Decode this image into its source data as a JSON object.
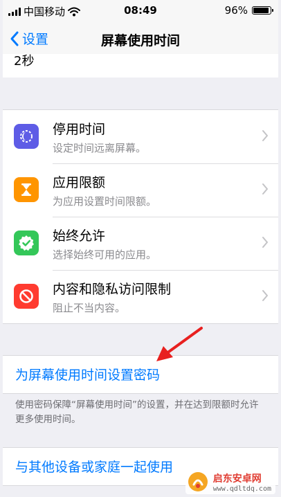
{
  "status_bar": {
    "carrier": "中国移动",
    "time": "08:49",
    "battery": "96%"
  },
  "nav": {
    "back_label": "设置",
    "title": "屏幕使用时间"
  },
  "partial_row": {
    "text": "2秒"
  },
  "list": [
    {
      "title": "停用时间",
      "subtitle": "设定时间远离屏幕。",
      "icon": "downtime-icon",
      "color": "#5e5ce6"
    },
    {
      "title": "应用限额",
      "subtitle": "为应用设置时间限额。",
      "icon": "hourglass-icon",
      "color": "#ff9500"
    },
    {
      "title": "始终允许",
      "subtitle": "选择始终可用的应用。",
      "icon": "checkmark-badge-icon",
      "color": "#34c759"
    },
    {
      "title": "内容和隐私访问限制",
      "subtitle": "阻止不当内容。",
      "icon": "no-entry-icon",
      "color": "#ff3b30"
    }
  ],
  "passcode_link": "为屏幕使用时间设置密码",
  "passcode_footnote": "使用密码保障“屏幕使用时间”的设置，并在达到限额时允许更多使用时间。",
  "family_link": "与其他设备或家庭一起使用",
  "watermark": {
    "name": "启东安卓网",
    "url": "www.qdltdq.com"
  },
  "colors": {
    "accent": "#007aff",
    "annotation_arrow": "#e8201f"
  }
}
